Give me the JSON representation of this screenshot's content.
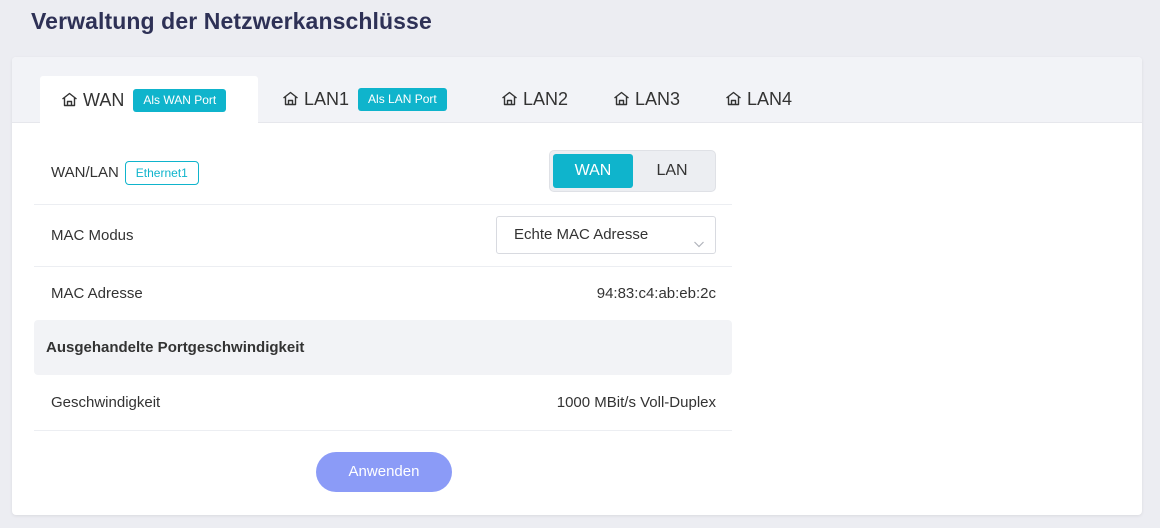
{
  "page": {
    "title": "Verwaltung der Netzwerkanschlüsse"
  },
  "tabs": [
    {
      "label": "WAN",
      "badge": "Als WAN Port",
      "icon": "house-icon",
      "active": true
    },
    {
      "label": "LAN1",
      "badge": "Als LAN Port",
      "icon": "house-icon",
      "active": false
    },
    {
      "label": "LAN2",
      "icon": "house-icon",
      "active": false
    },
    {
      "label": "LAN3",
      "icon": "house-icon",
      "active": false
    },
    {
      "label": "LAN4",
      "icon": "house-icon",
      "active": false
    }
  ],
  "wanlan": {
    "label": "WAN/LAN",
    "tag": "Ethernet1",
    "options": [
      "WAN",
      "LAN"
    ],
    "selected": "WAN"
  },
  "mac_mode": {
    "label": "MAC Modus",
    "value": "Echte MAC Adresse"
  },
  "mac_address": {
    "label": "MAC Adresse",
    "value": "94:83:c4:ab:eb:2c"
  },
  "speed_section": {
    "title": "Ausgehandelte Portgeschwindigkeit"
  },
  "speed": {
    "label": "Geschwindigkeit",
    "value": "1000 MBit/s Voll-Duplex"
  },
  "apply": {
    "label": "Anwenden"
  },
  "colors": {
    "accent": "#0fb4cc",
    "apply_button": "#8b9bf7",
    "title": "#2e3156"
  }
}
